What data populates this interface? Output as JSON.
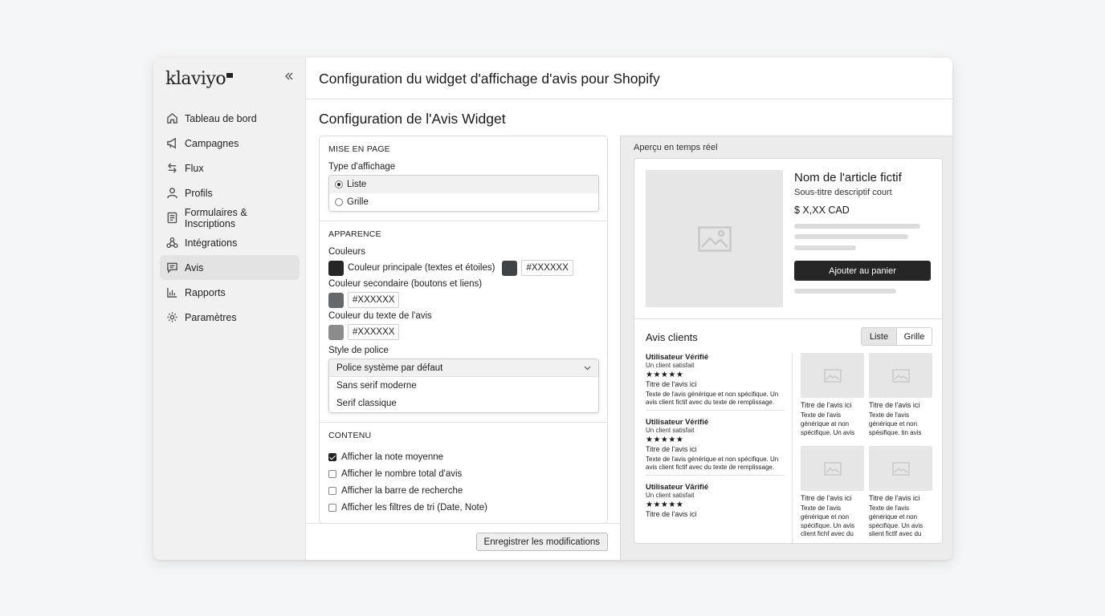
{
  "app": {
    "logo": "klaviyo",
    "collapse_icon": "double-chevron-left-icon"
  },
  "sidebar": {
    "items": [
      {
        "label": "Tableau de bord",
        "icon": "home-icon"
      },
      {
        "label": "Campagnes",
        "icon": "megaphone-icon"
      },
      {
        "label": "Flux",
        "icon": "arrows-icon"
      },
      {
        "label": "Profils",
        "icon": "user-icon"
      },
      {
        "label": "Formulaires & Inscriptions",
        "icon": "form-icon"
      },
      {
        "label": "Intégrations",
        "icon": "integrations-icon"
      },
      {
        "label": "Avis",
        "icon": "chat-icon",
        "active": true
      },
      {
        "label": "Rapports",
        "icon": "chart-icon"
      },
      {
        "label": "Paramètres",
        "icon": "gear-icon"
      }
    ]
  },
  "header": {
    "title": "Configuration du widget d'affichage d'avis pour Shopify"
  },
  "main": {
    "section_title": "Configuration de l'Avis Widget",
    "layout": {
      "group_title": "MISE EN PAGE",
      "display_type_label": "Type d'affichage",
      "options": [
        {
          "label": "Liste",
          "selected": true
        },
        {
          "label": "Grille",
          "selected": false
        }
      ]
    },
    "appearance": {
      "group_title": "APPARENCE",
      "colors_label": "Couleurs",
      "primary_label": "Couleur principale (textes et étoiles)",
      "primary_hex": "#XXXXXX",
      "secondary_label": "Couleur secondaire (boutons et liens)",
      "secondary_hex": "#XXXXXX",
      "text_color_label": "Couleur du texte de l'avis",
      "text_color_hex": "#XXXXXX",
      "swatch_colors": [
        "#262626",
        "#3e4347",
        "#65696c",
        "#8a8c8e"
      ],
      "font_style_label": "Style de police",
      "font_selected": "Police système par défaut",
      "font_options": [
        "Sans serif moderne",
        "Serif classique"
      ]
    },
    "content": {
      "group_title": "CONTENU",
      "checks": [
        {
          "label": "Afficher la note moyenne",
          "checked": true
        },
        {
          "label": "Afficher le nombre total d'avis",
          "checked": false
        },
        {
          "label": "Afficher la barre de recherche",
          "checked": false
        },
        {
          "label": "Afficher les filtres de tri (Date, Note)",
          "checked": false
        }
      ]
    },
    "save_label": "Enregistrer les modifications"
  },
  "preview": {
    "title": "Aperçu en temps réel",
    "product": {
      "name": "Nom de l'article fictif",
      "subtitle": "Sous-titre descriptif court",
      "price": "$ X,XX CAD",
      "cart_label": "Ajouter au panier"
    },
    "reviews": {
      "title": "Avis clients",
      "toggle_list": "Liste",
      "toggle_grid": "Grille",
      "list": [
        {
          "user": "Utilisateur Vérifié",
          "sub": "Un client satisfait",
          "stars": "★★★★★",
          "title": "Titre de l'avis ici",
          "text": "Texte de l'avis générique et non spécifique. Un avis client fictif avec du texte de remplissage."
        },
        {
          "user": "Utilisateur Vérifié",
          "sub": "Un client satisfait",
          "stars": "★★★★★",
          "title": "Titre de l'avis ici",
          "text": "Texte de l'avis générique et non spécifique. Un avis client fictif avec du texte de remplissage."
        },
        {
          "user": "Utilisateur Vârifié",
          "sub": "Un client satisfait",
          "stars": "★★★★★",
          "title": "Titre de l'avis ici",
          "text": ""
        }
      ],
      "grid": [
        {
          "title": "Titre de l'avis ici",
          "text": "Texte de l'avis générique at non spécifique. Un avis"
        },
        {
          "title": "Titre de l'avis ici",
          "text": "Texte de l'avis générique et non spésifique. tin avis"
        },
        {
          "title": "Titre de l'avis ici",
          "text": "Texte de l'avis générique et non spécifique. Un avis client fichf avec du"
        },
        {
          "title": "Titre de l'avis ici",
          "text": "Texte de l'avis générique et non spécifique. Un avis slient fictlf avec du"
        }
      ]
    }
  }
}
